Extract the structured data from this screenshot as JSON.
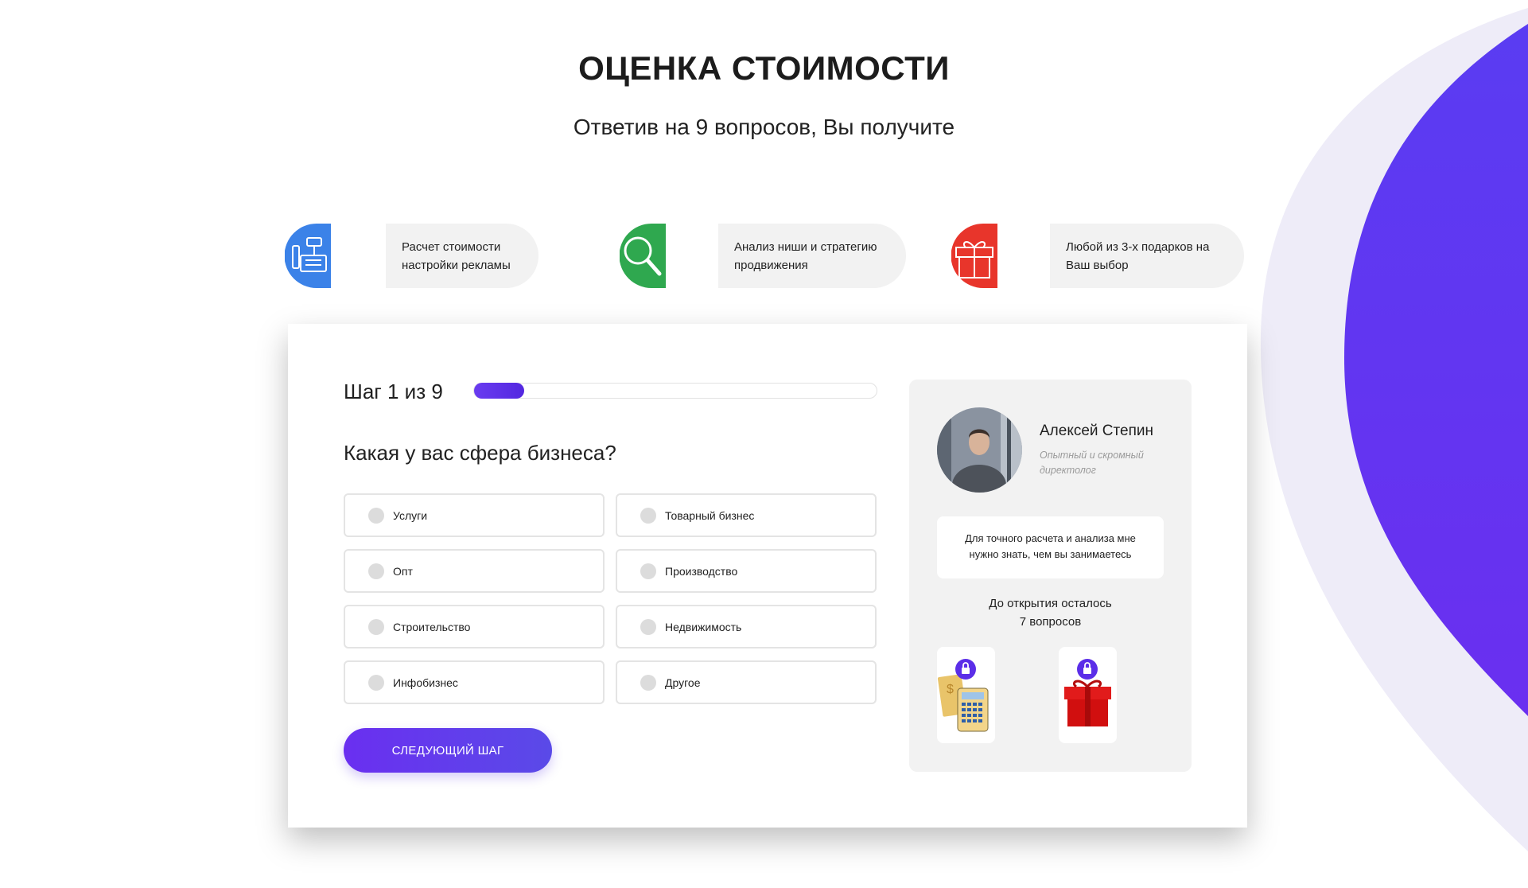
{
  "page": {
    "title": "ОЦЕНКА СТОИМОСТИ",
    "subtitle": "Ответив на 9 вопросов, Вы получите"
  },
  "benefits": [
    {
      "icon": "cash-register-icon",
      "color": "#3b82e8",
      "text_line1": "Расчет стоимости",
      "text_line2": "настройки рекламы"
    },
    {
      "icon": "magnifier-icon",
      "color": "#2fa84f",
      "text_line1": "Анализ ниши и стратегию",
      "text_line2": "продвижения"
    },
    {
      "icon": "gift-icon",
      "color": "#e8352b",
      "text_line1": "Любой из 3-х подарков на",
      "text_line2": "Ваш выбор"
    }
  ],
  "quiz": {
    "step_label": "Шаг 1 из 9",
    "progress": 0.125,
    "question": "Какая у вас сфера бизнеса?",
    "options": [
      "Услуги",
      "Товарный бизнес",
      "Опт",
      "Производство",
      "Строительство",
      "Недвижимость",
      "Инфобизнес",
      "Другое"
    ],
    "next_button": "СЛЕДУЮЩИЙ ШАГ"
  },
  "consultant": {
    "name": "Алексей Степин",
    "role": "Опытный и скромный директолог",
    "message_line1": "Для точного расчета и анализа мне",
    "message_line2": "нужно знать, чем вы занимаетесь",
    "remaining_line1": "До открытия осталось",
    "remaining_line2": "7 вопросов",
    "gifts": [
      {
        "icon": "calculator-gift-icon",
        "locked": true
      },
      {
        "icon": "gift-box-icon",
        "locked": true
      }
    ]
  },
  "colors": {
    "accent": "#5b2ee8",
    "card_bg": "#f2f2f2"
  }
}
